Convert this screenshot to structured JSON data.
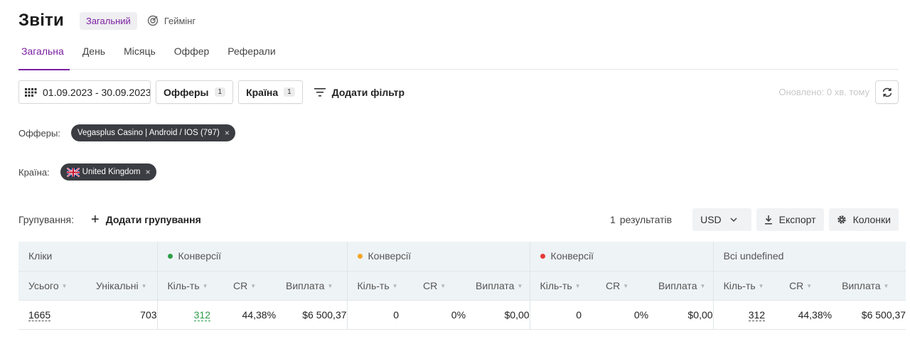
{
  "header": {
    "title": "Звіти",
    "badge": "Загальний",
    "gaming": "Геймінг"
  },
  "tabs": [
    {
      "label": "Загальна",
      "active": true
    },
    {
      "label": "День",
      "active": false
    },
    {
      "label": "Місяць",
      "active": false
    },
    {
      "label": "Оффер",
      "active": false
    },
    {
      "label": "Реферали",
      "active": false
    }
  ],
  "filters": {
    "date_range": "01.09.2023 - 30.09.2023",
    "offers_label": "Офферы",
    "offers_count": "1",
    "country_label": "Країна",
    "country_count": "1",
    "add_filter": "Додати фільтр",
    "updated": "Оновлено: 0 хв. тому"
  },
  "active_filters": {
    "offers_label": "Офферы:",
    "offer_chip": "Vegasplus Casino | Android / IOS (797)",
    "country_label": "Країна:",
    "country_chip": "United Kingdom",
    "chip_close": "×"
  },
  "grouping": {
    "label": "Групування:",
    "add": "Додати групування",
    "results_count": "1",
    "results_label": "результатів",
    "currency": "USD",
    "export": "Експорт",
    "columns": "Колонки"
  },
  "table": {
    "groups": [
      {
        "label": "Кліки",
        "dot": null
      },
      {
        "label": "Конверсії",
        "dot": "#2e9e49"
      },
      {
        "label": "Конверсії",
        "dot": "#f5a623"
      },
      {
        "label": "Конверсії",
        "dot": "#e53935"
      },
      {
        "label": "Всі undefined",
        "dot": null
      }
    ],
    "columns": [
      "Усього",
      "Унікальні",
      "Кіль-ть",
      "CR",
      "Виплата",
      "Кіль-ть",
      "CR",
      "Виплата",
      "Кіль-ть",
      "CR",
      "Виплата",
      "Кіль-ть",
      "CR",
      "Виплата"
    ],
    "row": [
      "1665",
      "703",
      "312",
      "44,38%",
      "$6 500,37",
      "0",
      "0%",
      "$0,00",
      "0",
      "0%",
      "$0,00",
      "312",
      "44,38%",
      "$6 500,37"
    ]
  },
  "colors": {
    "accent": "#7b1fa2",
    "approved": "#2e9e49",
    "pending": "#f5a623",
    "rejected": "#e53935"
  }
}
